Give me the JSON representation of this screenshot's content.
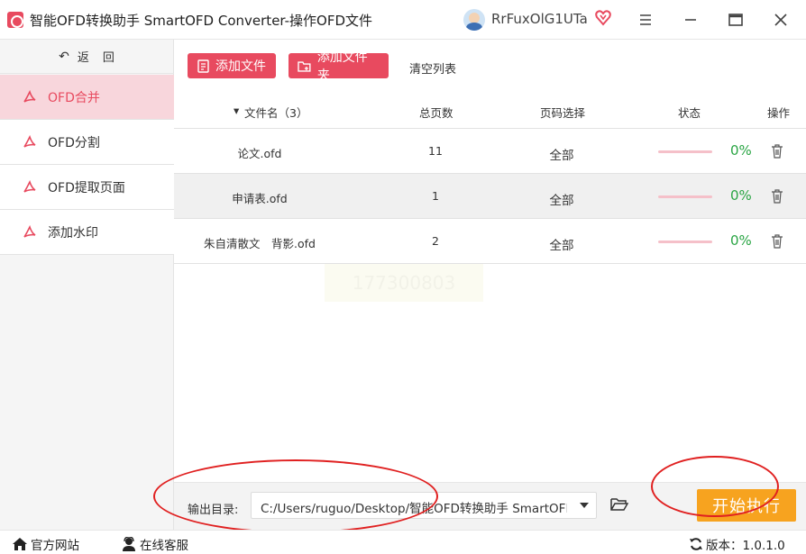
{
  "app": {
    "title": "智能OFD转换助手 SmartOFD Converter-操作OFD文件",
    "user_name": "RrFuxOlG1UTa"
  },
  "sidebar": {
    "back_label": "返　回",
    "items": [
      {
        "label": "OFD合并",
        "active": true
      },
      {
        "label": "OFD分割",
        "active": false
      },
      {
        "label": "OFD提取页面",
        "active": false
      },
      {
        "label": "添加水印",
        "active": false
      }
    ]
  },
  "toolbar": {
    "add_file": "添加文件",
    "add_folder": "添加文件夹",
    "clear_list": "清空列表"
  },
  "table": {
    "headers": {
      "name": "文件名（3）",
      "pages": "总页数",
      "range": "页码选择",
      "status": "状态",
      "ops": "操作"
    },
    "rows": [
      {
        "name": "论文.ofd",
        "pages": "11",
        "range": "全部",
        "progress": "0%"
      },
      {
        "name": "申请表.ofd",
        "pages": "1",
        "range": "全部",
        "progress": "0%"
      },
      {
        "name": "朱自清散文　背影.ofd",
        "pages": "2",
        "range": "全部",
        "progress": "0%"
      }
    ]
  },
  "watermark_text": "177300803",
  "output": {
    "label": "输出目录:",
    "path": "C:/Users/ruguo/Desktop/智能OFD转换助手 SmartOFD Converter",
    "start_label": "开始执行"
  },
  "statusbar": {
    "site": "官方网站",
    "support": "在线客服",
    "version": "版本：1.0.1.0"
  },
  "colors": {
    "accent": "#e84a5f",
    "active_bg": "#f8d6dc",
    "progress_text": "#2aa544",
    "start_button": "#f7a31f",
    "annotation": "#e02020"
  }
}
